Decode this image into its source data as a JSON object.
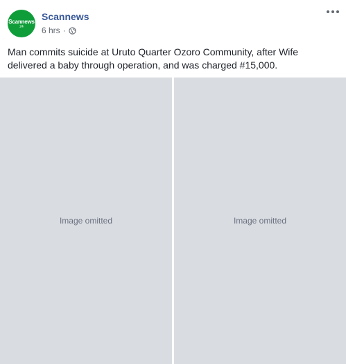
{
  "post": {
    "page_name": "Scannews",
    "timestamp": "6 hrs",
    "separator": "·",
    "privacy_icon": "globe-icon",
    "options_icon": "more-options-icon",
    "caption": "Man commits suicide at Uruto Quarter Ozoro Community, after Wife delivered a baby through operation, and was charged #15,000.",
    "avatar": {
      "text": "Scannews",
      "sub": "24",
      "color": "#0f9d3a"
    },
    "photos": [
      {
        "placeholder": "Image omitted"
      },
      {
        "placeholder": "Image omitted"
      }
    ]
  },
  "colors": {
    "link": "#385898",
    "text": "#1d2129",
    "meta": "#616770"
  }
}
